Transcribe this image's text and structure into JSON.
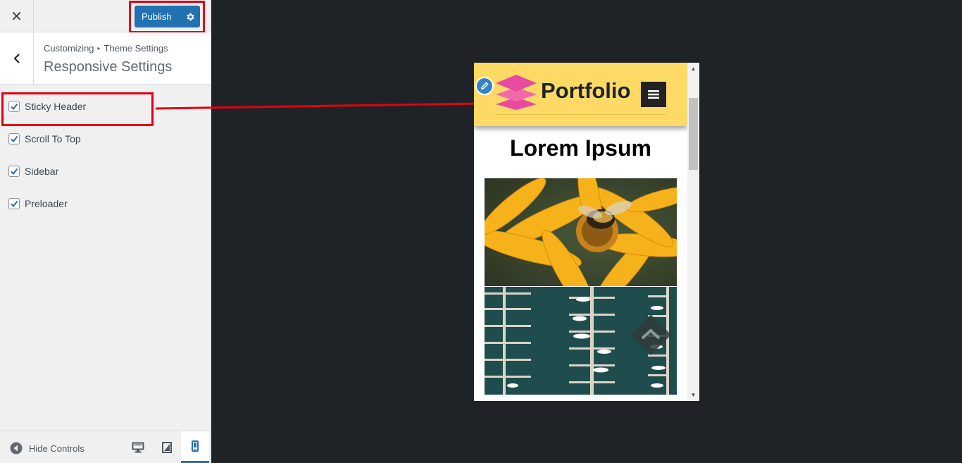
{
  "topbar": {
    "close_glyph": "✕",
    "publish_label": "Publish"
  },
  "section": {
    "breadcrumb_parent": "Customizing",
    "breadcrumb_sep": "▸",
    "breadcrumb_current": "Theme Settings",
    "title": "Responsive Settings"
  },
  "options": [
    {
      "label": "Sticky Header",
      "checked": true
    },
    {
      "label": "Scroll To Top",
      "checked": true
    },
    {
      "label": "Sidebar",
      "checked": true
    },
    {
      "label": "Preloader",
      "checked": true
    }
  ],
  "footer": {
    "hide_controls_label": "Hide Controls",
    "active_device": "mobile"
  },
  "preview": {
    "site_name": "Portfolio",
    "page_heading": "Lorem Ipsum",
    "scroll_up_glyph": "▲",
    "scroll_down_glyph": "▼"
  },
  "colors": {
    "accent": "#2271b1",
    "highlight": "#e3000f",
    "header_bg": "#fdd966",
    "logo_pink": "#e84a9f",
    "backdrop": "#1f2327"
  }
}
